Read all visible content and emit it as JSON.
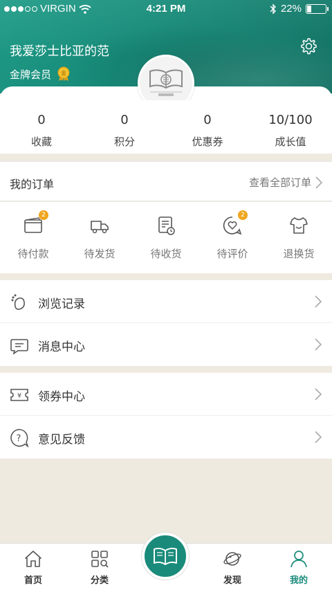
{
  "status_bar": {
    "carrier": "VIRGIN",
    "time": "4:21 PM",
    "battery": "22%"
  },
  "profile": {
    "username": "我爱莎士比亚的范",
    "member_level": "金牌会员",
    "avatar_icon": "book-logo-icon"
  },
  "stats": [
    {
      "value": "0",
      "label": "收藏"
    },
    {
      "value": "0",
      "label": "积分"
    },
    {
      "value": "0",
      "label": "优惠券"
    },
    {
      "value": "10/100",
      "label": "成长值"
    }
  ],
  "orders": {
    "title": "我的订单",
    "view_all": "查看全部订单",
    "items": [
      {
        "label": "待付款",
        "icon": "wallet-icon",
        "badge": "2"
      },
      {
        "label": "待发货",
        "icon": "truck-icon",
        "badge": ""
      },
      {
        "label": "待收货",
        "icon": "receipt-icon",
        "badge": ""
      },
      {
        "label": "待评价",
        "icon": "heart-comment-icon",
        "badge": "2"
      },
      {
        "label": "退换货",
        "icon": "shirt-return-icon",
        "badge": ""
      }
    ]
  },
  "list1": [
    {
      "label": "浏览记录",
      "icon": "footprint-icon"
    },
    {
      "label": "消息中心",
      "icon": "message-icon"
    }
  ],
  "list2": [
    {
      "label": "领券中心",
      "icon": "coupon-icon"
    },
    {
      "label": "意见反馈",
      "icon": "feedback-icon"
    }
  ],
  "nav": [
    {
      "label": "首页",
      "icon": "home-icon"
    },
    {
      "label": "分类",
      "icon": "category-icon"
    },
    {
      "label": "",
      "icon": "open-book-icon"
    },
    {
      "label": "发现",
      "icon": "planet-icon"
    },
    {
      "label": "我的",
      "icon": "user-icon"
    }
  ],
  "colors": {
    "accent": "#1a8b7b",
    "badge": "#f0a61e",
    "background": "#efeae0"
  }
}
